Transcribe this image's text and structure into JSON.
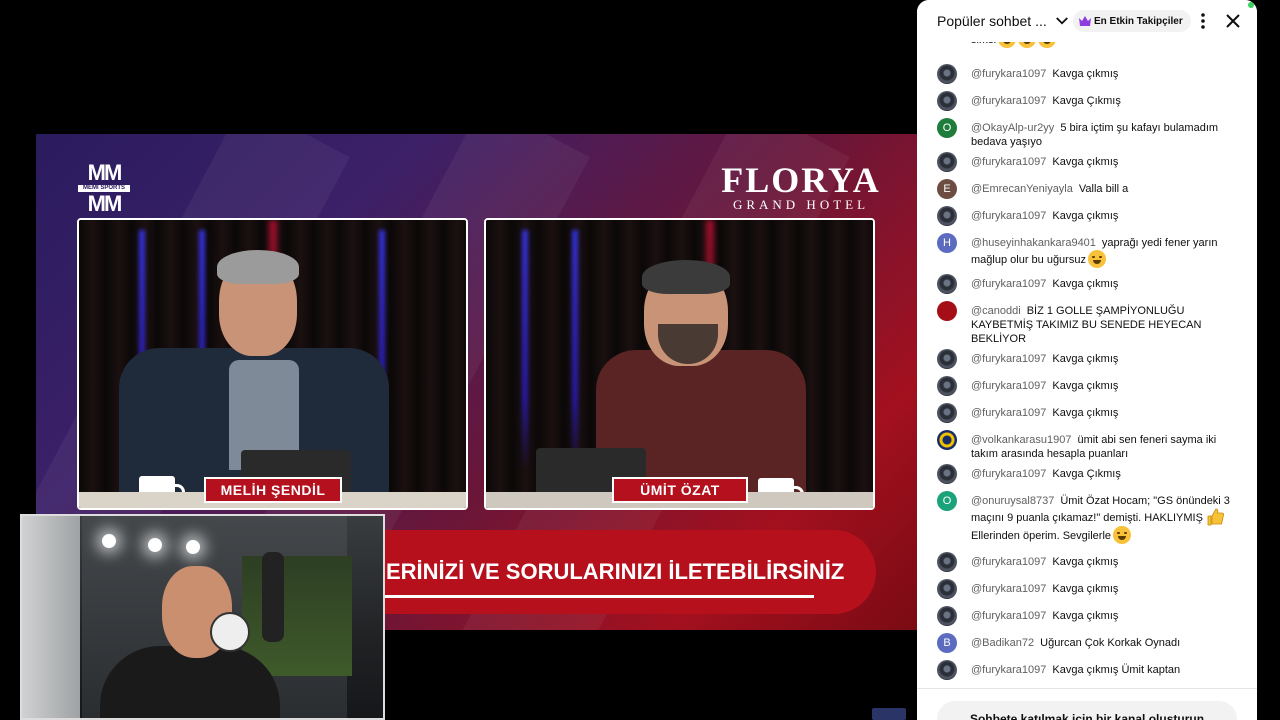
{
  "video": {
    "logo_left_top": "MM",
    "logo_left_mid": "MEMI SPORTS",
    "logo_left_bottom": "MM",
    "sponsor_brand": "FLORYA",
    "sponsor_sub": "GRAND HOTEL",
    "host1_name": "MELİH ŞENDİL",
    "host2_name": "ÜMİT ÖZAT",
    "ticker_text": "ERİNİZİ VE SORULARINIZI İLETEBİLİRSİNİZ",
    "colors": {
      "ticker": "#b5101c",
      "nameplate": "#b4101e"
    }
  },
  "chat": {
    "header_title": "Popüler sohbet ...",
    "chip_label": "En Etkin Takipçiler",
    "footer_button": "Sohbete katılmak için bir kanal oluşturun",
    "messages": [
      {
        "author": "",
        "text": "simsi",
        "avatar": "img",
        "emoji": 3
      },
      {
        "author": "@furykara1097",
        "text": "Kavga çıkmış",
        "avatar": "img"
      },
      {
        "author": "@furykara1097",
        "text": "Kavga Çıkmış",
        "avatar": "img"
      },
      {
        "author": "@OkayAlp-ur2yy",
        "text": "5 bira içtim şu kafayı bulamadım bedava yaşıyo",
        "avatar": "O",
        "color": "#1e7d3b"
      },
      {
        "author": "@furykara1097",
        "text": "Kavga çıkmış",
        "avatar": "img"
      },
      {
        "author": "@EmrecanYeniyayla",
        "text": "Valla bill a",
        "avatar": "E",
        "color": "#6d4c41"
      },
      {
        "author": "@furykara1097",
        "text": "Kavga çıkmış",
        "avatar": "img"
      },
      {
        "author": "@huseyinhakankara9401",
        "text": "yaprağı yedi fener yarın mağlup olur bu uğursuz",
        "avatar": "H",
        "color": "#5c6bc0",
        "emoji": 1
      },
      {
        "author": "@furykara1097",
        "text": "Kavga çıkmış",
        "avatar": "img"
      },
      {
        "author": "@canoddi",
        "text": "BİZ 1 GOLLE ŞAMPİYONLUĞU KAYBETMİŞ TAKIMIZ BU SENEDE HEYECAN BEKLİYOR",
        "avatar": "",
        "color": "#a50e16"
      },
      {
        "author": "@furykara1097",
        "text": "Kavga çıkmış",
        "avatar": "img"
      },
      {
        "author": "@furykara1097",
        "text": "Kavga çıkmış",
        "avatar": "img"
      },
      {
        "author": "@furykara1097",
        "text": "Kavga çıkmış",
        "avatar": "img"
      },
      {
        "author": "@volkankarasu1907",
        "text": "ümit abi sen feneri sayma iki takım arasında hesapla puanları",
        "avatar": "yb"
      },
      {
        "author": "@furykara1097",
        "text": "Kavga Çıkmış",
        "avatar": "img"
      },
      {
        "author": "@onuruysal8737",
        "text": "Ümit Özat Hocam; \"GS önündeki 3 maçını 9 puanla çıkamaz!\" demişti. HAKLIYMIŞ",
        "text2": "Ellerinden öperim. Sevgilerle",
        "avatar": "O",
        "color": "#1aa37a",
        "thumb": true,
        "emoji": 1
      },
      {
        "author": "@furykara1097",
        "text": "Kavga çıkmış",
        "avatar": "img"
      },
      {
        "author": "@furykara1097",
        "text": "Kavga çıkmış",
        "avatar": "img"
      },
      {
        "author": "@furykara1097",
        "text": "Kavga çıkmış",
        "avatar": "img"
      },
      {
        "author": "@Badikan72",
        "text": "Uğurcan Çok Korkak Oynadı",
        "avatar": "B",
        "color": "#5c6bc0"
      },
      {
        "author": "@furykara1097",
        "text": "Kavga çıkmış Ümit kaptan",
        "avatar": "img"
      }
    ]
  }
}
